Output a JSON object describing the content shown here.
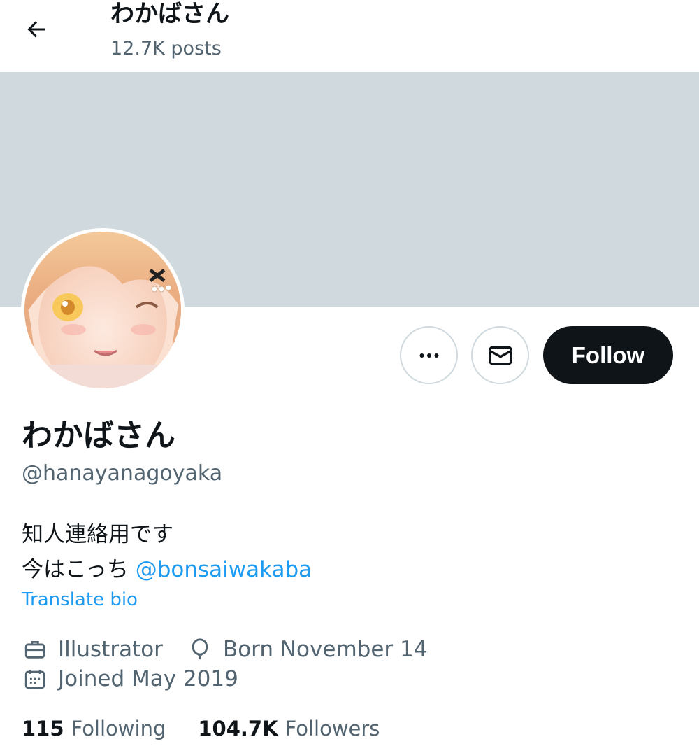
{
  "header": {
    "title": "わかばさん",
    "posts": "12.7K posts",
    "back_icon": "arrow-left-icon"
  },
  "profile": {
    "display_name": "わかばさん",
    "handle": "@hanayanagoyaka",
    "bio_line1": "知人連絡用です",
    "bio_line2_prefix": "今はこっち ",
    "bio_mention": "@bonsaiwakaba",
    "translate_label": "Translate bio",
    "profession": "Illustrator",
    "birthday": "Born November 14",
    "joined": "Joined May 2019"
  },
  "actions": {
    "more_icon": "more-icon",
    "message_icon": "mail-icon",
    "follow_label": "Follow"
  },
  "stats": {
    "following_count": "115",
    "following_label": "Following",
    "followers_count": "104.7K",
    "followers_label": "Followers"
  },
  "colors": {
    "banner": "#cfd9de",
    "accent": "#1d9bf0",
    "text_primary": "#0f1419",
    "text_secondary": "#536471",
    "follow_button": "#0f1419"
  }
}
